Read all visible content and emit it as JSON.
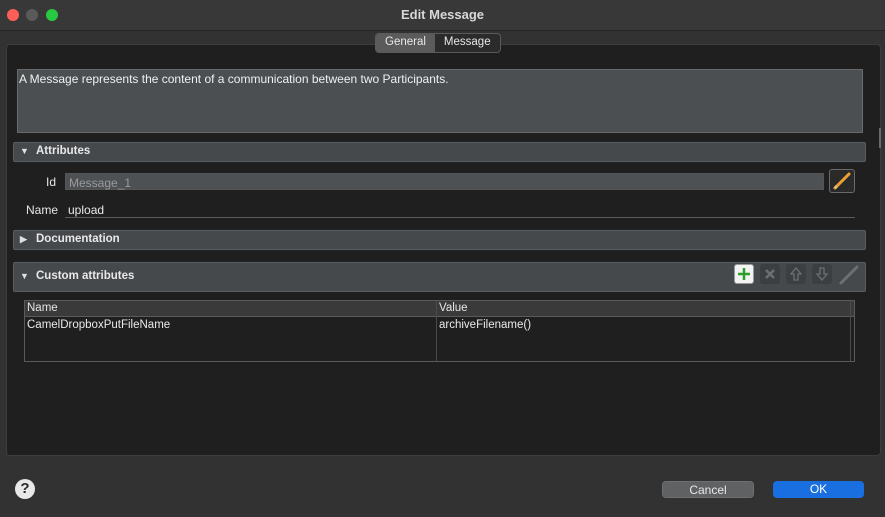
{
  "window": {
    "title": "Edit Message"
  },
  "tabs": [
    {
      "label": "General"
    },
    {
      "label": "Message"
    }
  ],
  "description": "A Message represents the content of a communication between two Participants.",
  "sections": {
    "attributes": "Attributes",
    "documentation": "Documentation",
    "custom_attributes": "Custom attributes"
  },
  "fields": {
    "id_label": "Id",
    "id_value": "Message_1",
    "name_label": "Name",
    "name_value": "upload"
  },
  "table": {
    "headers": [
      "Name",
      "Value"
    ],
    "rows": [
      [
        "CamelDropboxPutFileName",
        "archiveFilename()"
      ]
    ]
  },
  "footer": {
    "help": "?",
    "cancel": "Cancel",
    "ok": "OK"
  },
  "icons": {
    "edit": "pencil-icon",
    "add": "plus-icon",
    "remove": "x-icon",
    "up": "arrow-up-icon",
    "down": "arrow-down-icon",
    "edit_row": "pencil-icon"
  }
}
